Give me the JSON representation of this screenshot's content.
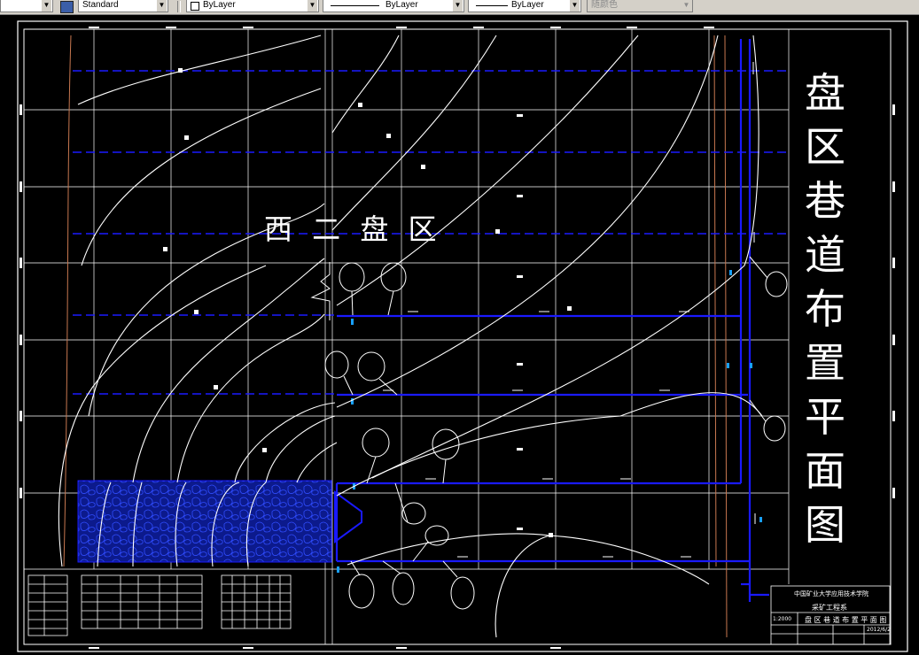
{
  "toolbar": {
    "text_style": "Standard",
    "layer_color": "ByLayer",
    "linetype": "ByLayer",
    "lineweight": "ByLayer",
    "plot_style": "随颜色"
  },
  "drawing": {
    "panel_label": "西 二 盘 区",
    "title_chars": [
      "盘",
      "区",
      "巷",
      "道",
      "布",
      "置",
      "平",
      "面",
      "图"
    ],
    "title_block": {
      "institute": "中国矿业大学应用技术学院",
      "department": "采矿工程系",
      "drawing_name": "盘 区 巷 道 布 置 平 面 图",
      "scale": "1:2000",
      "date": "2012/6/2"
    },
    "colors": {
      "background": "#000000",
      "roadway_blue": "#1a1aff",
      "contour_white": "#ffffff",
      "grid": "#ffffff",
      "boundary_orange": "#c87850",
      "fill_blue": "#1428b4",
      "toolbar_gray": "#d4d0c8"
    }
  }
}
